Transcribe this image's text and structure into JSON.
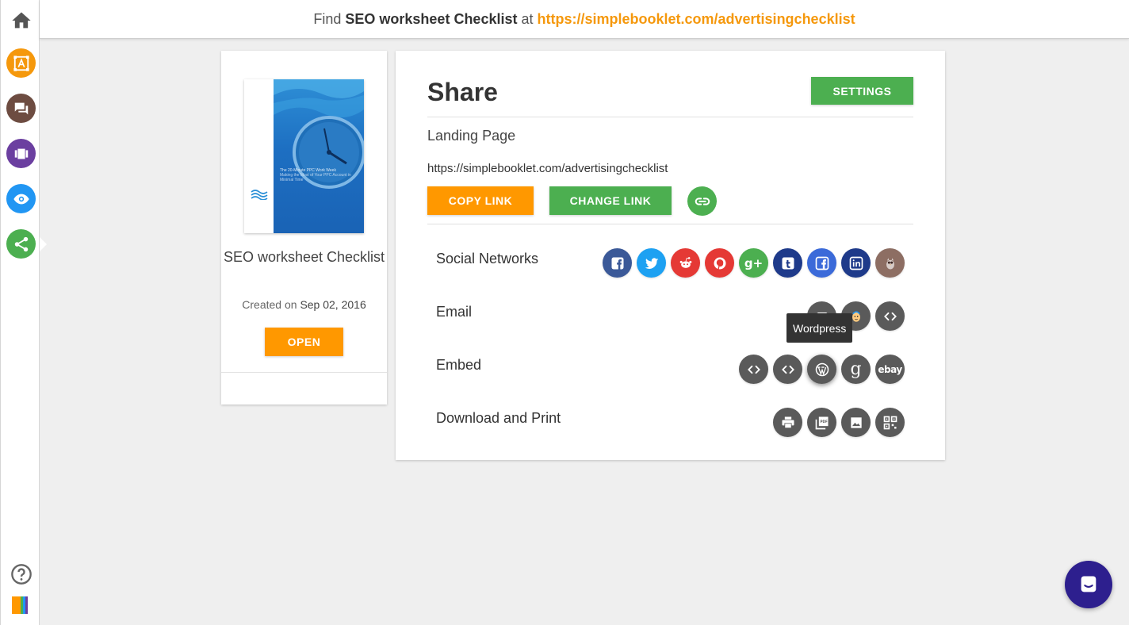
{
  "banner": {
    "prefix": "Find",
    "title": "SEO worksheet Checklist",
    "middle": "at",
    "url": "https://simplebooklet.com/advertisingchecklist"
  },
  "sidebar": {
    "items": [
      {
        "icon": "home-icon"
      },
      {
        "icon": "design-icon",
        "color": "#f5980c"
      },
      {
        "icon": "comments-icon",
        "color": "#6d4c41"
      },
      {
        "icon": "pages-icon",
        "color": "#6b3fa0"
      },
      {
        "icon": "eye-icon",
        "color": "#2196f3"
      },
      {
        "icon": "share-icon",
        "color": "#4caf50"
      },
      {
        "icon": "help-icon"
      }
    ]
  },
  "booklet": {
    "cover_text": "The 20-Minute PPC Work Week",
    "cover_subtext": "Making the Most of Your PPC Account in Minimal Time",
    "title": "SEO worksheet Checklist",
    "created_label": "Created on",
    "created_date": "Sep 02, 2016",
    "open_label": "OPEN"
  },
  "share": {
    "title": "Share",
    "settings_label": "SETTINGS",
    "landing_label": "Landing Page",
    "landing_url": "https://simplebooklet.com/advertisingchecklist",
    "copy_label": "COPY LINK",
    "change_label": "CHANGE LINK",
    "rows": {
      "social": "Social Networks",
      "email": "Email",
      "embed": "Embed",
      "download": "Download and Print"
    },
    "social_icons": [
      {
        "name": "facebook",
        "color": "#3b5998",
        "glyph": "f"
      },
      {
        "name": "twitter",
        "color": "#1da1f2",
        "glyph": ""
      },
      {
        "name": "reddit",
        "color": "#e53935",
        "glyph": ""
      },
      {
        "name": "pinterest",
        "color": "#e53935",
        "glyph": "P"
      },
      {
        "name": "google-plus",
        "color": "#4caf50",
        "glyph": "g+"
      },
      {
        "name": "tumblr",
        "color": "#1e3a8a",
        "glyph": "t"
      },
      {
        "name": "facebook-page",
        "color": "#3b6ad9",
        "glyph": "f"
      },
      {
        "name": "linkedin",
        "color": "#1e3a8a",
        "glyph": "in"
      },
      {
        "name": "hootsuite",
        "color": "#8d6e63",
        "glyph": ""
      }
    ],
    "tooltip": "Wordpress",
    "colors": {
      "orange": "#ff9800",
      "green": "#4caf50",
      "dark_icon": "#5a5a5a"
    }
  }
}
